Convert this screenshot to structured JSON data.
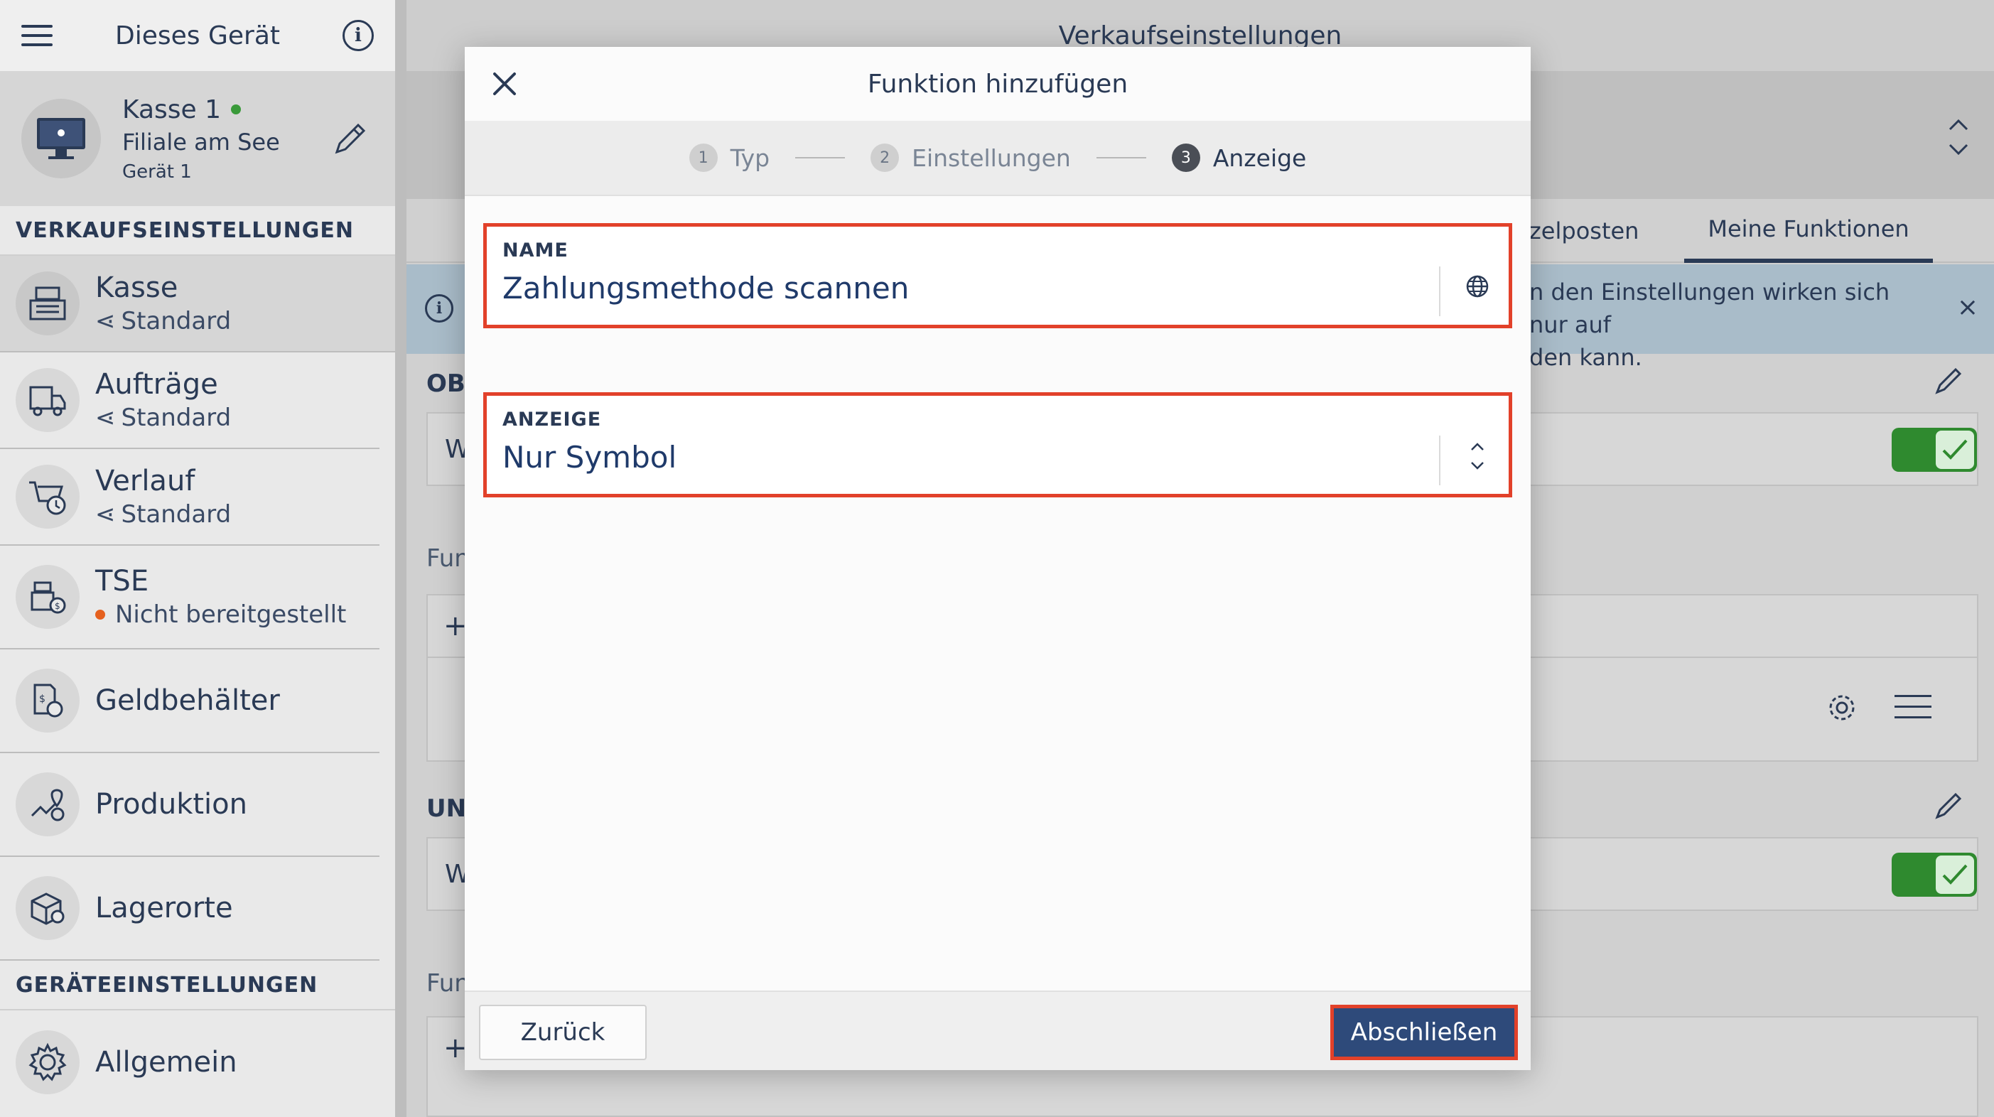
{
  "sidebar": {
    "header_title": "Dieses Gerät",
    "device": {
      "name": "Kasse 1",
      "location": "Filiale am See",
      "device_label": "Gerät 1"
    },
    "section_sales": "VERKAUFSEINSTELLUNGEN",
    "section_device": "GERÄTEEINSTELLUNGEN",
    "items": [
      {
        "title": "Kasse",
        "sub": "Standard"
      },
      {
        "title": "Aufträge",
        "sub": "Standard"
      },
      {
        "title": "Verlauf",
        "sub": "Standard"
      },
      {
        "title": "TSE",
        "sub": "Nicht bereitgestellt"
      },
      {
        "title": "Geldbehälter"
      },
      {
        "title": "Produktion"
      },
      {
        "title": "Lagerorte"
      },
      {
        "title": "Allgemein"
      }
    ]
  },
  "main": {
    "title": "Verkaufseinstellungen",
    "tabs": [
      "zelposten",
      "Meine Funktionen"
    ],
    "banner_text": "n den Einstellungen wirken sich nur auf\nden kann.",
    "banner_close": "×",
    "section_1": "OBI",
    "section_2": "UN",
    "row_w": "W",
    "fun_label": "Fun",
    "plus": "+"
  },
  "modal": {
    "title": "Funktion hinzufügen",
    "steps": [
      {
        "num": "1",
        "label": "Typ"
      },
      {
        "num": "2",
        "label": "Einstellungen"
      },
      {
        "num": "3",
        "label": "Anzeige"
      }
    ],
    "name_field": {
      "label": "NAME",
      "value": "Zahlungsmethode scannen"
    },
    "display_field": {
      "label": "ANZEIGE",
      "value": "Nur Symbol"
    },
    "back_label": "Zurück",
    "finish_label": "Abschließen"
  },
  "colors": {
    "primary": "#2e4a7a",
    "highlight": "#e2412a",
    "toggle_on": "#2f8a2f",
    "status_online": "#3a9a3a",
    "status_warning": "#e5601e"
  }
}
